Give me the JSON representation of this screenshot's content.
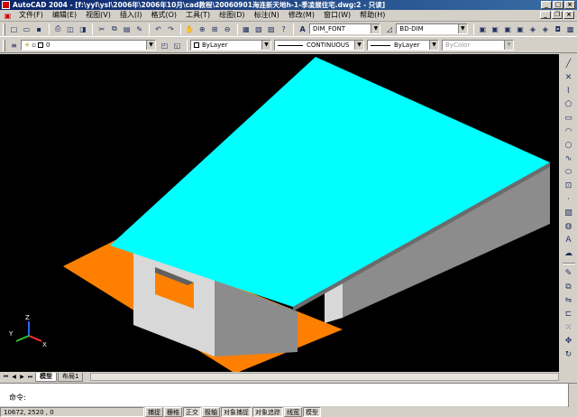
{
  "window": {
    "title": "AutoCAD 2004 - [f:\\yyl\\ysl\\2006年\\2006年10月\\cad教程\\20060901海连新天地h-1-季凌展住宅.dwg:2 - 只读]"
  },
  "menubar": {
    "items": [
      "文件(F)",
      "编辑(E)",
      "视图(V)",
      "插入(I)",
      "格式(O)",
      "工具(T)",
      "绘图(D)",
      "标注(N)",
      "修改(M)",
      "窗口(W)",
      "帮助(H)"
    ]
  },
  "toolbar": {
    "text_style": "DIM_FONT",
    "dim_style": "BD-DIM",
    "layer": "0",
    "color": "ByLayer",
    "linetype": "CONTINUOUS",
    "lineweight": "ByLayer",
    "plotstyle": "ByColor"
  },
  "tabs": [
    "模型",
    "布局1"
  ],
  "command": {
    "prompt": "命令:"
  },
  "status": {
    "coords": "10672, 2520 , 0",
    "buttons": [
      "捕捉",
      "栅格",
      "正交",
      "极轴",
      "对象捕捉",
      "对象追踪",
      "线宽",
      "模型"
    ]
  },
  "ucs": {
    "x_label": "X",
    "y_label": "Y",
    "z_label": "Z"
  },
  "colors": {
    "roof": "#00ffff",
    "floor": "#ff8000",
    "wall_front": "#d8d8d8",
    "wall_side": "#8c8c8c",
    "background": "#000000"
  }
}
